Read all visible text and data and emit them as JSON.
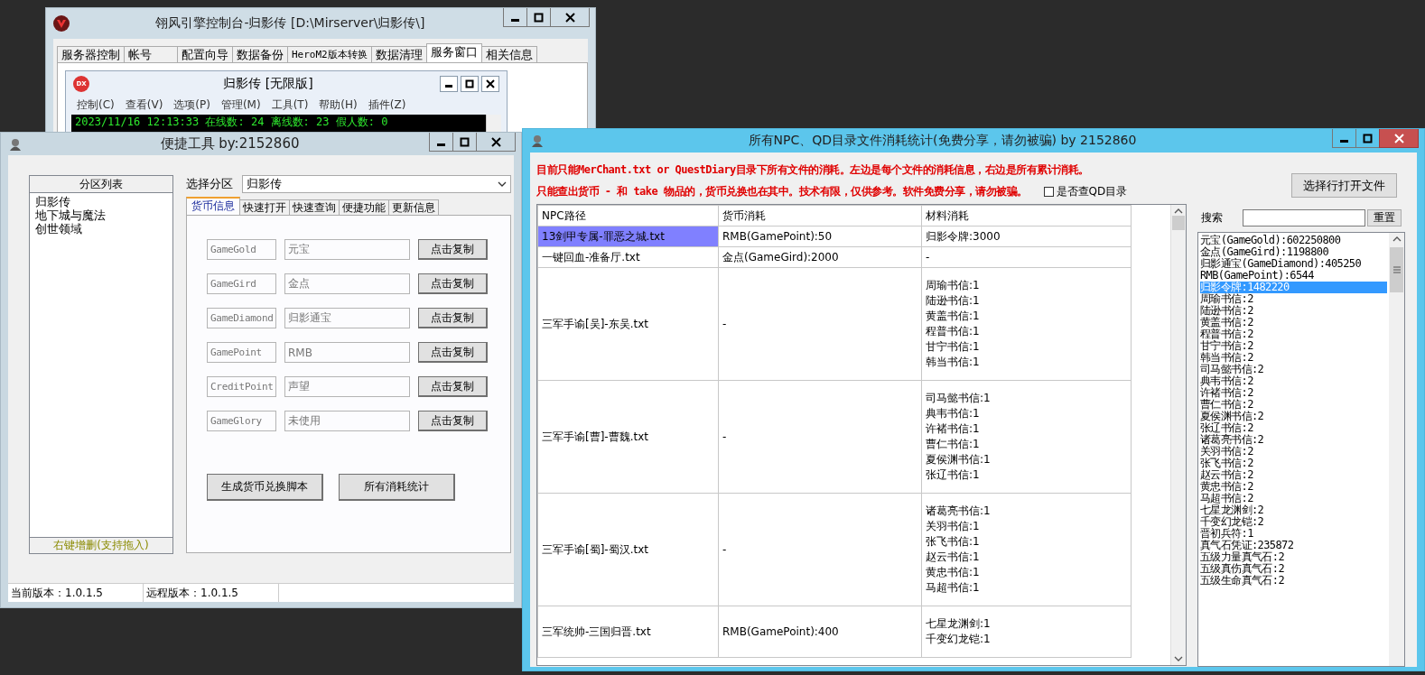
{
  "console_window": {
    "title": "翎风引擎控制台-归影传 [D:\\Mirserver\\归影传\\]",
    "tabs": [
      {
        "label": "服务器控制",
        "selected": false
      },
      {
        "label": "帐号",
        "selected": false
      },
      {
        "label": "配置向导",
        "selected": false
      },
      {
        "label": "数据备份",
        "selected": false
      },
      {
        "label": "HeroM2版本转换",
        "selected": false
      },
      {
        "label": "数据清理",
        "selected": false
      },
      {
        "label": "服务窗口",
        "selected": true
      },
      {
        "label": "相关信息",
        "selected": false
      }
    ],
    "server_window": {
      "icon_label": "DX",
      "title": "归影传 [无限版]",
      "menu": [
        "控制(C)",
        "查看(V)",
        "选项(P)",
        "管理(M)",
        "工具(T)",
        "帮助(H)",
        "插件(Z)"
      ],
      "log": [
        "2023/11/16 12:13:33 在线数: 24 离线数: 23 假人数: 0"
      ]
    }
  },
  "tool_window": {
    "title": "便捷工具  by:2152860",
    "partition_list": {
      "header": "分区列表",
      "footer": "右键增删(支持拖入)",
      "items": [
        {
          "label": "归影传",
          "selected": false
        },
        {
          "label": "地下城与魔法",
          "selected": false
        },
        {
          "label": "创世领域",
          "selected": false
        }
      ]
    },
    "select_label": "选择分区",
    "select_value": "归影传",
    "tabs": [
      {
        "label": "货币信息",
        "selected": true
      },
      {
        "label": "快速打开",
        "selected": false
      },
      {
        "label": "快速查询",
        "selected": false
      },
      {
        "label": "便捷功能",
        "selected": false
      },
      {
        "label": "更新信息",
        "selected": false
      }
    ],
    "currencies": [
      {
        "key": "GameGold",
        "name": "元宝",
        "button": "点击复制"
      },
      {
        "key": "GameGird",
        "name": "金点",
        "button": "点击复制"
      },
      {
        "key": "GameDiamond",
        "name": "归影通宝",
        "button": "点击复制"
      },
      {
        "key": "GamePoint",
        "name": "RMB",
        "button": "点击复制"
      },
      {
        "key": "CreditPoint",
        "name": "声望",
        "button": "点击复制"
      },
      {
        "key": "GameGlory",
        "name": "未使用",
        "button": "点击复制"
      }
    ],
    "buttons": [
      "生成货币兑换脚本",
      "所有消耗统计"
    ],
    "status_bar": [
      "当前版本：1.0.1.5",
      "远程版本：1.0.1.5"
    ]
  },
  "stats_window": {
    "title": "所有NPC、QD目录文件消耗统计(免费分享，请勿被骗)    by 2152860",
    "notes": [
      "目前只能MerChant.txt or QuestDiary目录下所有文件的消耗。左边是每个文件的消耗信息，右边是所有累计消耗。",
      "只能查出货币 - 和 take 物品的，货币兑换也在其中。技术有限，仅供参考。软件免费分享，请勿被骗。"
    ],
    "qd_checkbox": {
      "label": "是否查QD目录",
      "checked": false
    },
    "open_button": "选择行打开文件",
    "table": {
      "columns": [
        "NPC路径",
        "货币消耗",
        "材料消耗"
      ],
      "rows": [
        {
          "path": "13剑甲专属-罪恶之城.txt",
          "currency": "RMB(GamePoint):50",
          "materials": [
            "归影令牌:3000"
          ],
          "selected": true
        },
        {
          "path": "一键回血-准备厅.txt",
          "currency": "金点(GameGird):2000",
          "materials": [
            "-"
          ],
          "selected": false
        },
        {
          "path": "三军手谕[吴]-东吴.txt",
          "currency": "-",
          "materials": [
            "周瑜书信:1",
            "陆逊书信:1",
            "黄盖书信:1",
            "程普书信:1",
            "甘宁书信:1",
            "韩当书信:1"
          ],
          "selected": false
        },
        {
          "path": "三军手谕[曹]-曹魏.txt",
          "currency": "-",
          "materials": [
            "司马懿书信:1",
            "典韦书信:1",
            "许褚书信:1",
            "曹仁书信:1",
            "夏侯渊书信:1",
            "张辽书信:1"
          ],
          "selected": false
        },
        {
          "path": "三军手谕[蜀]-蜀汉.txt",
          "currency": "-",
          "materials": [
            "诸葛亮书信:1",
            "关羽书信:1",
            "张飞书信:1",
            "赵云书信:1",
            "黄忠书信:1",
            "马超书信:1"
          ],
          "selected": false
        },
        {
          "path": "三军统帅-三国归晋.txt",
          "currency": "RMB(GamePoint):400",
          "materials": [
            "七星龙渊剑:1",
            "千变幻龙铠:1"
          ],
          "selected": false
        }
      ]
    },
    "search": {
      "label": "搜索"
    },
    "reset_button": "重置",
    "totals": [
      {
        "text": "元宝(GameGold):602250800",
        "selected": false
      },
      {
        "text": "金点(GameGird):1198800",
        "selected": false
      },
      {
        "text": "归影通宝(GameDiamond):405250",
        "selected": false
      },
      {
        "text": "RMB(GamePoint):6544",
        "selected": false
      },
      {
        "text": "归影令牌:1482220",
        "selected": true
      },
      {
        "text": "周瑜书信:2",
        "selected": false
      },
      {
        "text": "陆逊书信:2",
        "selected": false
      },
      {
        "text": "黄盖书信:2",
        "selected": false
      },
      {
        "text": "程普书信:2",
        "selected": false
      },
      {
        "text": "甘宁书信:2",
        "selected": false
      },
      {
        "text": "韩当书信:2",
        "selected": false
      },
      {
        "text": "司马懿书信:2",
        "selected": false
      },
      {
        "text": "典韦书信:2",
        "selected": false
      },
      {
        "text": "许褚书信:2",
        "selected": false
      },
      {
        "text": "曹仁书信:2",
        "selected": false
      },
      {
        "text": "夏侯渊书信:2",
        "selected": false
      },
      {
        "text": "张辽书信:2",
        "selected": false
      },
      {
        "text": "诸葛亮书信:2",
        "selected": false
      },
      {
        "text": "关羽书信:2",
        "selected": false
      },
      {
        "text": "张飞书信:2",
        "selected": false
      },
      {
        "text": "赵云书信:2",
        "selected": false
      },
      {
        "text": "黄忠书信:2",
        "selected": false
      },
      {
        "text": "马超书信:2",
        "selected": false
      },
      {
        "text": "七星龙渊剑:2",
        "selected": false
      },
      {
        "text": "千变幻龙铠:2",
        "selected": false
      },
      {
        "text": "晋初兵符:1",
        "selected": false
      },
      {
        "text": "真气石凭证:235872",
        "selected": false
      },
      {
        "text": "五级力量真气石:2",
        "selected": false
      },
      {
        "text": "五级真伤真气石:2",
        "selected": false
      },
      {
        "text": "五级生命真气石:2",
        "selected": false
      }
    ]
  }
}
